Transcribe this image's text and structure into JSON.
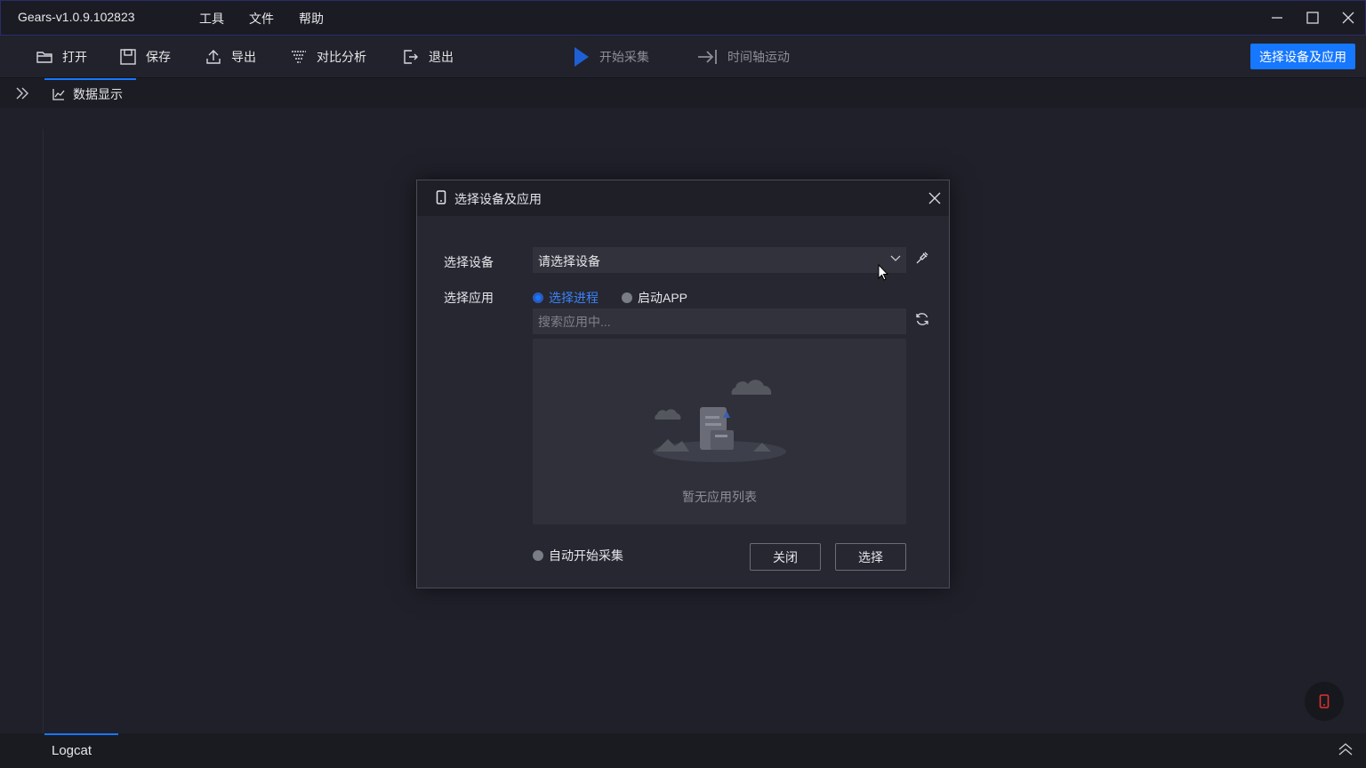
{
  "window": {
    "title": "Gears-v1.0.9.102823",
    "menu": [
      "工具",
      "文件",
      "帮助"
    ]
  },
  "toolbar": {
    "open": "打开",
    "save": "保存",
    "export": "导出",
    "compare": "对比分析",
    "exit": "退出",
    "start_capture": "开始采集",
    "timeline": "时间轴运动",
    "select_device_app": "选择设备及应用"
  },
  "tabs": {
    "data_display": "数据显示",
    "logcat": "Logcat"
  },
  "dialog": {
    "title": "选择设备及应用",
    "device_label": "选择设备",
    "device_value": "请选择设备",
    "app_label": "选择应用",
    "radio_process": "选择进程",
    "radio_launch": "启动APP",
    "search_placeholder": "搜索应用中...",
    "empty_list": "暂无应用列表",
    "auto_start": "自动开始采集",
    "close_button": "关闭",
    "select_button": "选择"
  },
  "colors": {
    "accent": "#1677ff",
    "background": "#1f2029",
    "alert_icon": "#e03131"
  }
}
